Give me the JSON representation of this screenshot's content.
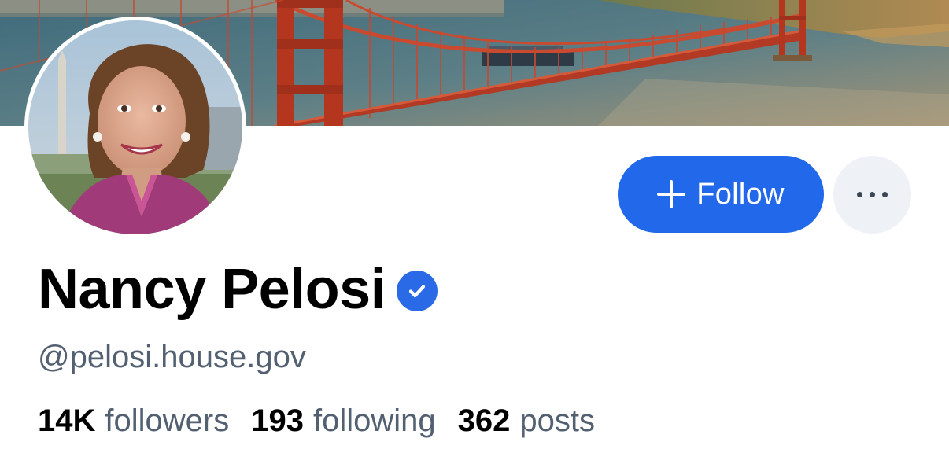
{
  "profile": {
    "display_name": "Nancy Pelosi",
    "handle": "@pelosi.house.gov",
    "verified": true,
    "banner_icon": "golden-gate-bridge-photo",
    "avatar_icon": "portrait-photo"
  },
  "actions": {
    "follow_label": "Follow",
    "follow_icon": "plus-icon",
    "more_icon": "ellipsis-icon"
  },
  "stats": [
    {
      "value": "14K",
      "label": "followers"
    },
    {
      "value": "193",
      "label": "following"
    },
    {
      "value": "362",
      "label": "posts"
    }
  ],
  "colors": {
    "accent": "#2168ea",
    "secondary_text": "#526071",
    "more_button_bg": "#eef1f5"
  }
}
